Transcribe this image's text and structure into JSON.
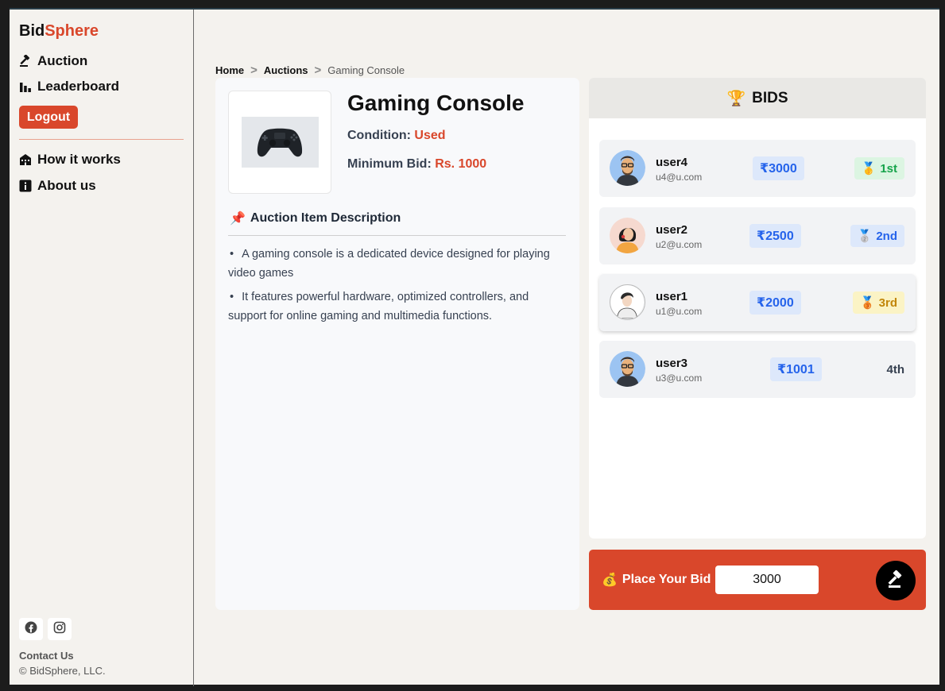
{
  "brand": {
    "part1": "Bid",
    "part2": "Sphere"
  },
  "sidebar": {
    "nav": [
      {
        "label": "Auction",
        "icon": "gavel-icon"
      },
      {
        "label": "Leaderboard",
        "icon": "bar-chart-icon"
      }
    ],
    "logout_label": "Logout",
    "secondary": [
      {
        "label": "How it works",
        "icon": "building-icon"
      },
      {
        "label": "About us",
        "icon": "info-icon"
      }
    ],
    "social": [
      "facebook-icon",
      "instagram-icon"
    ],
    "contact_label": "Contact Us",
    "copyright": "© BidSphere, LLC."
  },
  "breadcrumb": {
    "home": "Home",
    "auctions": "Auctions",
    "current": "Gaming Console",
    "separator": ">"
  },
  "item": {
    "title": "Gaming Console",
    "condition_label": "Condition:",
    "condition_value": "Used",
    "min_bid_label": "Minimum Bid:",
    "min_bid_value": "Rs. 1000",
    "description_heading": "Auction Item Description",
    "description": [
      "A gaming console is a dedicated device designed for playing video games",
      "It features powerful hardware, optimized controllers, and support for online gaming and multimedia functions."
    ]
  },
  "bids": {
    "heading": "BIDS",
    "rows": [
      {
        "user": "user4",
        "email": "u4@u.com",
        "amount": "₹3000",
        "rank": "1st",
        "medal": "🥇"
      },
      {
        "user": "user2",
        "email": "u2@u.com",
        "amount": "₹2500",
        "rank": "2nd",
        "medal": "🥈"
      },
      {
        "user": "user1",
        "email": "u1@u.com",
        "amount": "₹2000",
        "rank": "3rd",
        "medal": "🥉"
      },
      {
        "user": "user3",
        "email": "u3@u.com",
        "amount": "₹1001",
        "rank": "4th",
        "medal": ""
      }
    ]
  },
  "place_bid": {
    "label": "Place Your Bid",
    "value": "3000"
  },
  "colors": {
    "accent": "#d9472b",
    "amount_text": "#2563eb",
    "amount_bg": "#dde8fb"
  }
}
